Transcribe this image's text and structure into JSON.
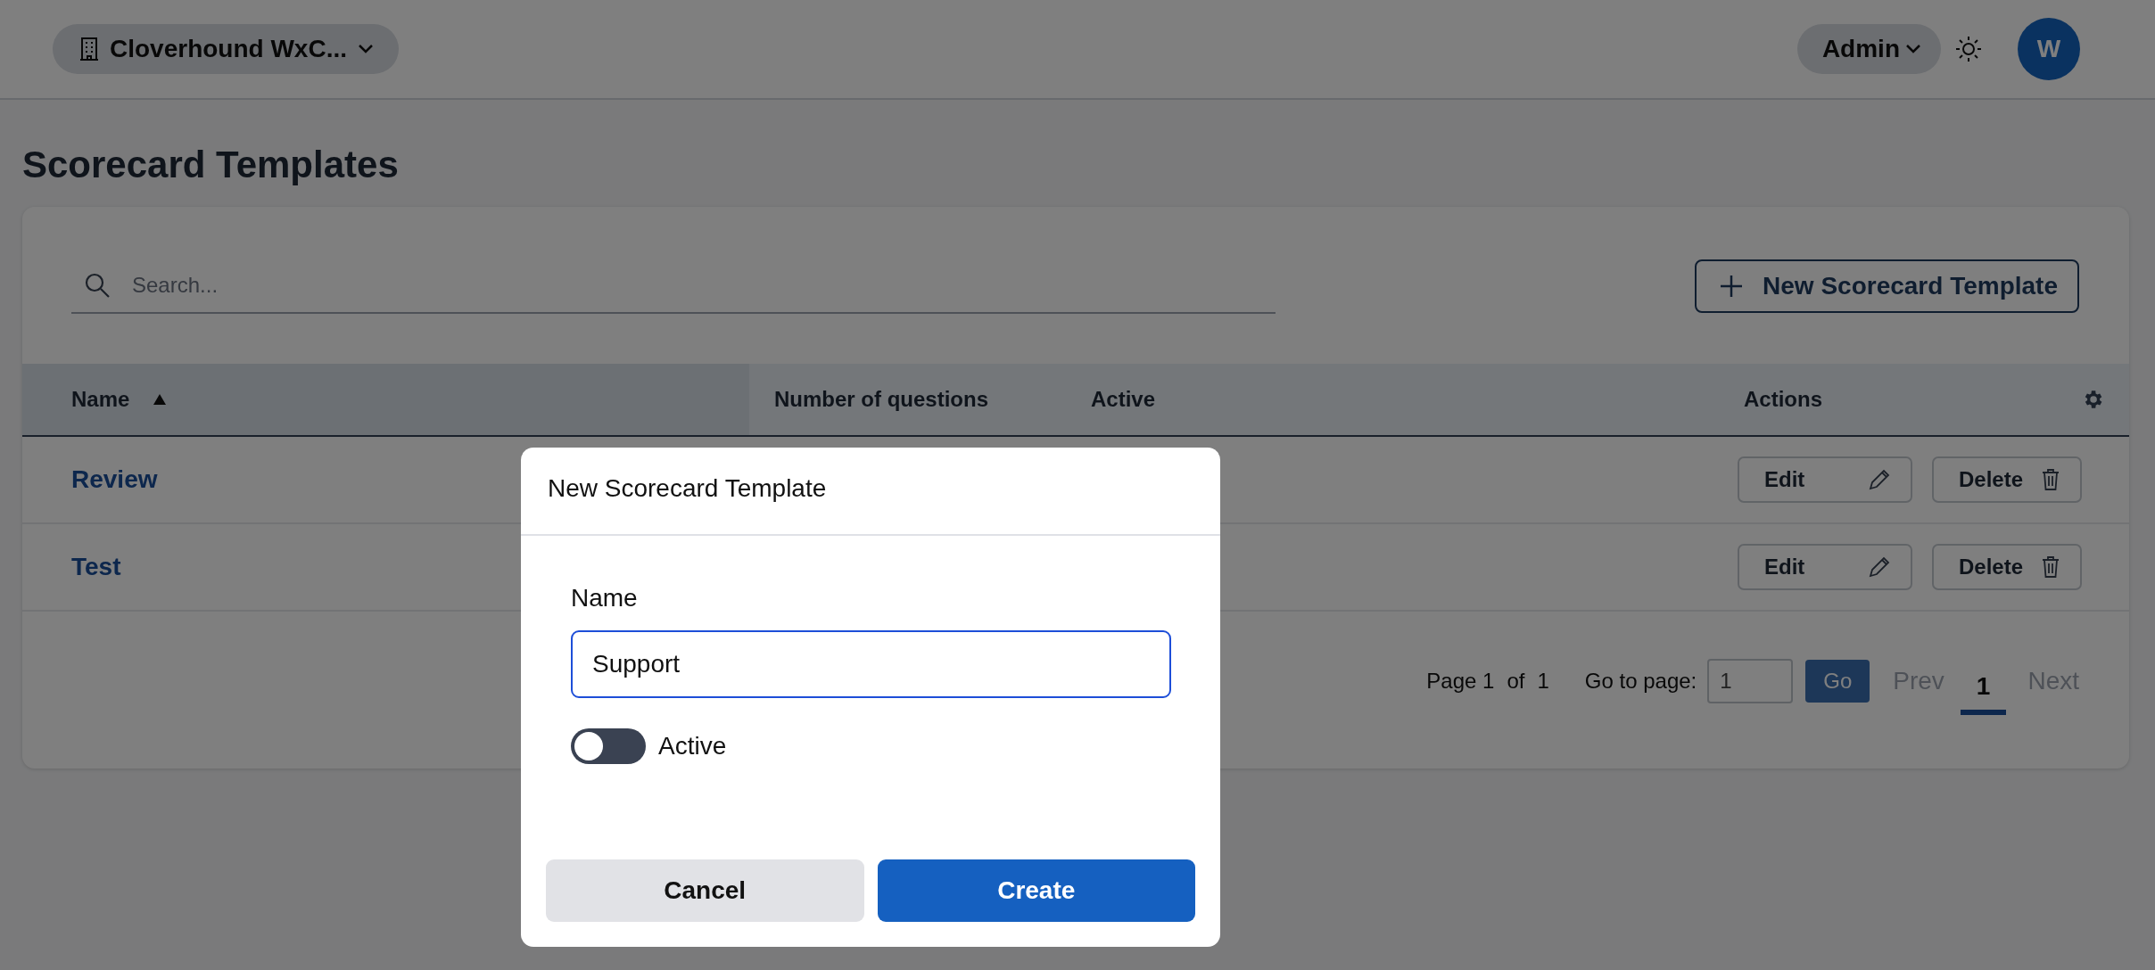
{
  "header": {
    "organization": "Cloverhound WxC...",
    "role_menu": "Admin",
    "avatar_initial": "W"
  },
  "page_title": "Scorecard Templates",
  "search": {
    "placeholder": "Search..."
  },
  "new_button": "New Scorecard Template",
  "table": {
    "columns": [
      {
        "label": "Name",
        "sorted": true
      },
      {
        "label": "Number of questions",
        "sorted": false
      },
      {
        "label": "Active",
        "sorted": false
      },
      {
        "label": "Actions",
        "sorted": false
      }
    ],
    "rows": [
      {
        "name": "Review",
        "actions": [
          "Edit",
          "Delete"
        ]
      },
      {
        "name": "Test",
        "actions": [
          "Edit",
          "Delete"
        ]
      }
    ]
  },
  "pagination": {
    "page_label": "Page 1",
    "of_label": "of",
    "total_pages": "1",
    "goto_label": "Go to page:",
    "goto_value": "1",
    "go_button": "Go",
    "prev": {
      "label": "Prev",
      "disabled": true
    },
    "pages": [
      {
        "label": "1",
        "selected": true
      }
    ],
    "next": {
      "label": "Next",
      "disabled": true
    }
  },
  "dialog": {
    "title": "New Scorecard Template",
    "name_label": "Name",
    "name_value": "Support",
    "active": {
      "label": "Active",
      "on": false
    },
    "buttons": [
      {
        "label": "Cancel",
        "kind": "secondary"
      },
      {
        "label": "Create",
        "kind": "primary"
      }
    ]
  }
}
